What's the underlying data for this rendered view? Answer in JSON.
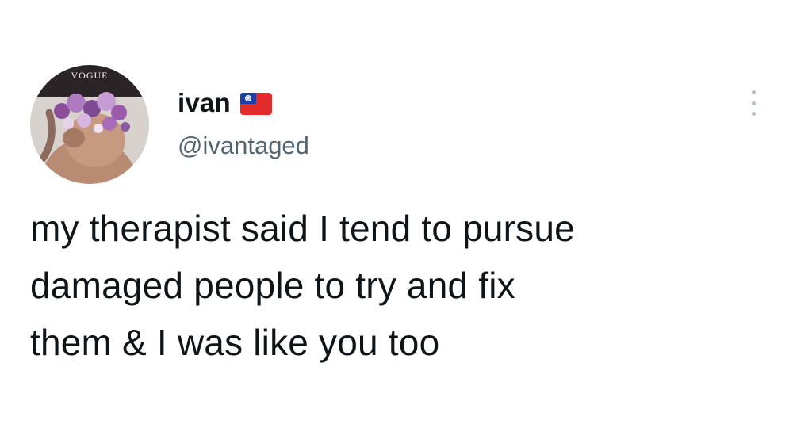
{
  "tweet": {
    "author": {
      "display_name": "ivan",
      "handle": "@ivantaged",
      "flag_icon": "taiwan-flag-icon",
      "avatar_icon": "profile-photo",
      "avatar_overlay_text": "VOGUE"
    },
    "more_icon": "more-options-icon",
    "text_lines": [
      "my therapist said I tend to pursue",
      "damaged people to try and fix",
      "them & I was like you too"
    ]
  },
  "colors": {
    "text_primary": "#0f1419",
    "text_secondary": "#536471",
    "flag_red": "#e42b2b",
    "flag_blue": "#1b3fa8"
  }
}
